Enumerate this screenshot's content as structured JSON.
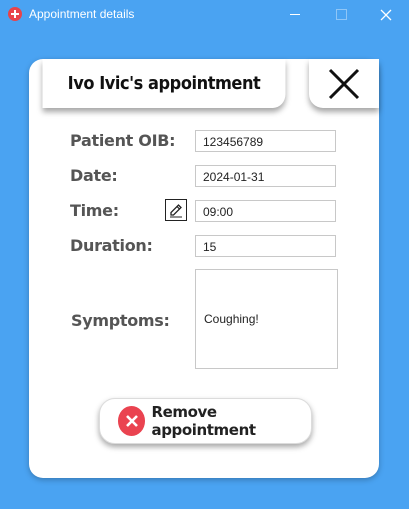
{
  "window": {
    "title": "Appointment details",
    "icon": "red-cross-icon",
    "controls": {
      "minimize": "—",
      "maximize": "☐",
      "close": "✕"
    }
  },
  "header": {
    "title": "Ivo Ivic's appointment",
    "close_icon": "close-x-icon"
  },
  "form": {
    "oib": {
      "label": "Patient OIB:",
      "value": "123456789"
    },
    "date": {
      "label": "Date:",
      "value": "2024-01-31"
    },
    "time": {
      "label": "Time:",
      "value": "09:00",
      "edit_icon": "edit-icon"
    },
    "duration": {
      "label": "Duration:",
      "value": "15"
    },
    "symptoms": {
      "label": "Symptoms:",
      "value": "Coughing!"
    }
  },
  "actions": {
    "remove_label": "Remove appointment",
    "remove_icon": "remove-x-circle-icon"
  },
  "colors": {
    "background": "#4aa3f2",
    "card": "#ffffff",
    "label_text": "#555555",
    "remove_icon": "#ea4350"
  }
}
